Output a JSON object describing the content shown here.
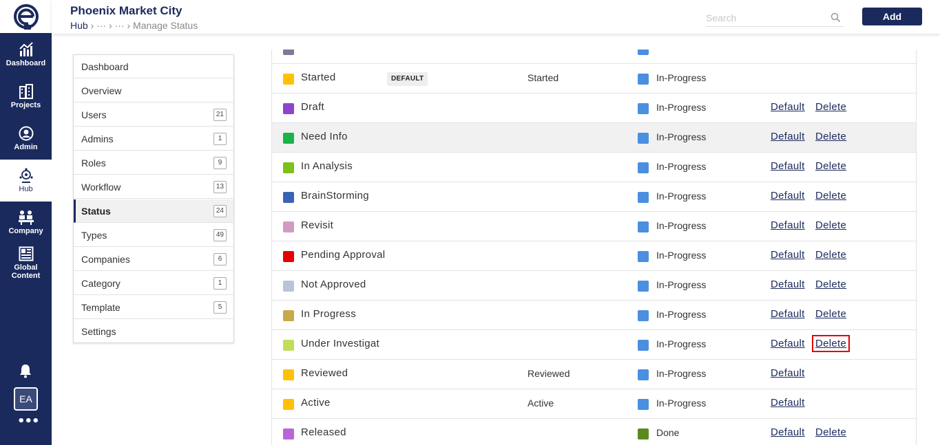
{
  "rail": {
    "items": [
      {
        "label": "Dashboard",
        "icon": "chart-icon"
      },
      {
        "label": "Projects",
        "icon": "buildings-icon"
      },
      {
        "label": "Admin",
        "icon": "user-circle-icon"
      },
      {
        "label": "Hub",
        "icon": "hub-icon"
      },
      {
        "label": "Company",
        "icon": "company-icon"
      },
      {
        "label": "Global Content",
        "icon": "global-content-icon"
      }
    ],
    "active": "Hub",
    "avatar": "EA",
    "more": "•••"
  },
  "header": {
    "title": "Phoenix Market City",
    "breadcrumb": {
      "first": "Hub",
      "sep": " › ",
      "ellipsis": "···",
      "current": "Manage Status"
    },
    "search_placeholder": "Search",
    "add_label": "Add"
  },
  "menu": {
    "items": [
      {
        "label": "Dashboard",
        "count": ""
      },
      {
        "label": "Overview",
        "count": ""
      },
      {
        "label": "Users",
        "count": "21"
      },
      {
        "label": "Admins",
        "count": "1"
      },
      {
        "label": "Roles",
        "count": "9"
      },
      {
        "label": "Workflow",
        "count": "13"
      },
      {
        "label": "Status",
        "count": "24"
      },
      {
        "label": "Types",
        "count": "49"
      },
      {
        "label": "Companies",
        "count": "6"
      },
      {
        "label": "Category",
        "count": "1"
      },
      {
        "label": "Template",
        "count": "5"
      },
      {
        "label": "Settings",
        "count": ""
      }
    ],
    "active": "Status"
  },
  "status_list": {
    "default_badge": "DEFAULT",
    "link_default": "Default",
    "link_delete": "Delete",
    "rows": [
      {
        "name": "Started",
        "color": "#ffc107",
        "badge": true,
        "mapped": "Started",
        "category": "In-Progress",
        "cat_color": "#4a8fe0",
        "show_default": false,
        "show_delete": false
      },
      {
        "name": "Draft",
        "color": "#8e44cc",
        "badge": false,
        "mapped": "",
        "category": "In-Progress",
        "cat_color": "#4a8fe0",
        "show_default": true,
        "show_delete": true
      },
      {
        "name": "Need Info",
        "color": "#19b34a",
        "badge": false,
        "mapped": "",
        "category": "In-Progress",
        "cat_color": "#4a8fe0",
        "show_default": true,
        "show_delete": true,
        "highlight": true
      },
      {
        "name": "In Analysis",
        "color": "#7cc21a",
        "badge": false,
        "mapped": "",
        "category": "In-Progress",
        "cat_color": "#4a8fe0",
        "show_default": true,
        "show_delete": true
      },
      {
        "name": "BrainStorming",
        "color": "#3b63b5",
        "badge": false,
        "mapped": "",
        "category": "In-Progress",
        "cat_color": "#4a8fe0",
        "show_default": true,
        "show_delete": true
      },
      {
        "name": "Revisit",
        "color": "#d39ac4",
        "badge": false,
        "mapped": "",
        "category": "In-Progress",
        "cat_color": "#4a8fe0",
        "show_default": true,
        "show_delete": true
      },
      {
        "name": "Pending Approval",
        "color": "#e60000",
        "badge": false,
        "mapped": "",
        "category": "In-Progress",
        "cat_color": "#4a8fe0",
        "show_default": true,
        "show_delete": true
      },
      {
        "name": "Not Approved",
        "color": "#b9c4d9",
        "badge": false,
        "mapped": "",
        "category": "In-Progress",
        "cat_color": "#4a8fe0",
        "show_default": true,
        "show_delete": true
      },
      {
        "name": "In Progress",
        "color": "#c9a84a",
        "badge": false,
        "mapped": "",
        "category": "In-Progress",
        "cat_color": "#4a8fe0",
        "show_default": true,
        "show_delete": true
      },
      {
        "name": "Under Investigat",
        "color": "#c2dd5c",
        "badge": false,
        "mapped": "",
        "category": "In-Progress",
        "cat_color": "#4a8fe0",
        "show_default": true,
        "show_delete": true,
        "delete_boxed": true
      },
      {
        "name": "Reviewed",
        "color": "#ffc107",
        "badge": false,
        "mapped": "Reviewed",
        "category": "In-Progress",
        "cat_color": "#4a8fe0",
        "show_default": true,
        "show_delete": false
      },
      {
        "name": "Active",
        "color": "#ffc107",
        "badge": false,
        "mapped": "Active",
        "category": "In-Progress",
        "cat_color": "#4a8fe0",
        "show_default": true,
        "show_delete": false
      },
      {
        "name": "Released",
        "color": "#b865d6",
        "badge": false,
        "mapped": "",
        "category": "Done",
        "cat_color": "#5a8a1e",
        "show_default": true,
        "show_delete": true
      }
    ]
  }
}
